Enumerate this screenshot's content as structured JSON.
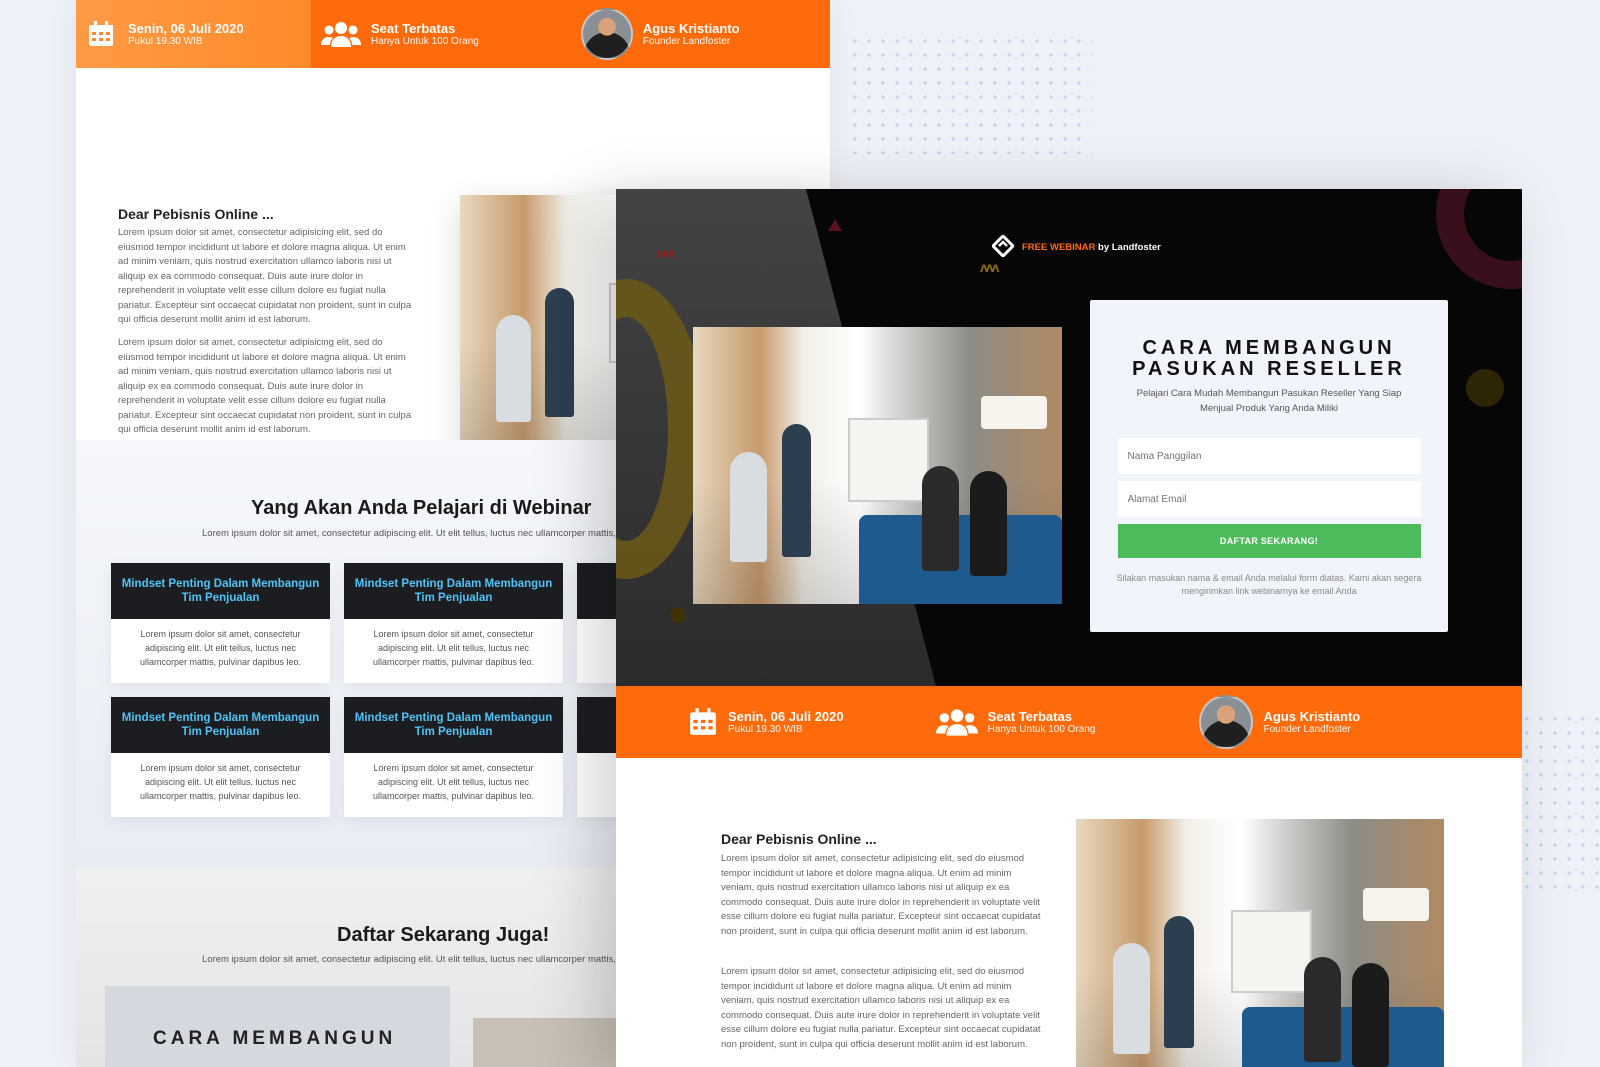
{
  "event": {
    "date": "Senin, 06 Juli 2020",
    "time": "Pukul 19.30 WIB",
    "seat_title": "Seat Terbatas",
    "seat_sub": "Hanya Untuk 100 Orang",
    "speaker_name": "Agus Kristianto",
    "speaker_role": "Founder Landfoster"
  },
  "brand": {
    "highlight": "FREE WEBINAR",
    "rest": "by Landfoster"
  },
  "registration": {
    "title_line1": "CARA MEMBANGUN",
    "title_line2": "PASUKAN RESELLER",
    "description": "Pelajari Cara Mudah Membangun Pasukan Reseller Yang Siap Menjual Produk Yang Anda Miliki",
    "name_placeholder": "Nama Panggilan",
    "email_placeholder": "Alamat Email",
    "button_label": "DAFTAR SEKARANG!",
    "note": "Silakan masukan nama & email Anda melalui form diatas. Kami akan segera mengirimkan link webinarnya ke email Anda"
  },
  "intro": {
    "greeting": "Dear Pebisnis Online ...",
    "paragraph1": "Lorem ipsum dolor sit amet, consectetur adipisicing elit, sed do eiusmod tempor incididunt ut labore et dolore magna aliqua. Ut enim ad minim veniam, quis nostrud exercitation ullamco laboris nisi ut aliquip ex ea commodo consequat. Duis aute irure dolor in reprehenderit in voluptate velit esse cillum dolore eu fugiat nulla pariatur. Excepteur sint occaecat cupidatat non proident, sunt in culpa qui officia deserunt mollit anim id est laborum.",
    "paragraph2": "Lorem ipsum dolor sit amet, consectetur adipisicing elit, sed do eiusmod tempor incididunt ut labore et dolore magna aliqua. Ut enim ad minim veniam, quis nostrud exercitation ullamco laboris nisi ut aliquip ex ea commodo consequat. Duis aute irure dolor in reprehenderit in voluptate velit esse cillum dolore eu fugiat nulla pariatur. Excepteur sint occaecat cupidatat non proident, sunt in culpa qui officia deserunt mollit anim id est laborum."
  },
  "learn": {
    "title": "Yang Akan Anda Pelajari di Webinar",
    "subtitle": "Lorem ipsum dolor sit amet, consectetur adipiscing elit. Ut elit tellus, luctus nec ullamcorper mattis,",
    "cards": [
      {
        "title": "Mindset Penting Dalam Membangun Tim Penjualan",
        "body": "Lorem ipsum dolor sit amet, consectetur adipiscing elit. Ut elit tellus, luctus nec ullamcorper mattis, pulvinar dapibus leo."
      },
      {
        "title": "Mindset Penting Dalam Membangun Tim Penjualan",
        "body": "Lorem ipsum dolor sit amet, consectetur adipiscing elit. Ut elit tellus, luctus nec ullamcorper mattis, pulvinar dapibus leo."
      },
      {
        "title": "Mindset Penting Dalam Membangun Tim Penjualan",
        "body": "Lorem ipsum dolor sit amet, consectetur adipiscing elit. Ut elit tellus, luctus nec ullamcorper mattis, pulvinar dapibus leo."
      },
      {
        "title": "Mindset Penting Dalam Membangun Tim Penjualan",
        "body": "Lorem ipsum dolor sit amet, consectetur adipiscing elit. Ut elit tellus, luctus nec ullamcorper mattis, pulvinar dapibus leo."
      }
    ]
  },
  "cta": {
    "title": "Daftar Sekarang Juga!",
    "subtitle": "Lorem ipsum dolor sit amet, consectetur adipiscing elit. Ut elit tellus, luctus nec ullamcorper mattis,",
    "form_title": "CARA MEMBANGUN"
  },
  "colors": {
    "accent_orange": "#ff6b0a",
    "card_header": "#1c1d20",
    "card_title": "#4fc3f7",
    "button_green": "#4dbb5c"
  },
  "icons": [
    "calendar-icon",
    "users-icon",
    "logo-icon"
  ]
}
